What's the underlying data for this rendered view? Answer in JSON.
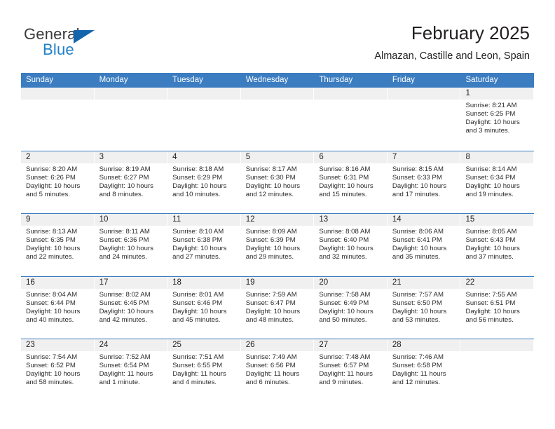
{
  "brand": {
    "name_top": "General",
    "name_bottom": "Blue",
    "accent_color": "#2081c8",
    "triangle_color": "#1565ad"
  },
  "header": {
    "title": "February 2025",
    "subtitle": "Almazan, Castille and Leon, Spain"
  },
  "theme": {
    "header_row_bg": "#3b7dc0",
    "daynum_band_bg": "#f0f0f0",
    "text_color": "#231f20",
    "row_divider": "#3b7dc0"
  },
  "calendar": {
    "weekday_headers": [
      "Sunday",
      "Monday",
      "Tuesday",
      "Wednesday",
      "Thursday",
      "Friday",
      "Saturday"
    ],
    "weeks": [
      [
        {
          "day": "",
          "lines": []
        },
        {
          "day": "",
          "lines": []
        },
        {
          "day": "",
          "lines": []
        },
        {
          "day": "",
          "lines": []
        },
        {
          "day": "",
          "lines": []
        },
        {
          "day": "",
          "lines": []
        },
        {
          "day": "1",
          "sunrise": "Sunrise: 8:21 AM",
          "sunset": "Sunset: 6:25 PM",
          "daylight_1": "Daylight: 10 hours",
          "daylight_2": "and 3 minutes."
        }
      ],
      [
        {
          "day": "2",
          "sunrise": "Sunrise: 8:20 AM",
          "sunset": "Sunset: 6:26 PM",
          "daylight_1": "Daylight: 10 hours",
          "daylight_2": "and 5 minutes."
        },
        {
          "day": "3",
          "sunrise": "Sunrise: 8:19 AM",
          "sunset": "Sunset: 6:27 PM",
          "daylight_1": "Daylight: 10 hours",
          "daylight_2": "and 8 minutes."
        },
        {
          "day": "4",
          "sunrise": "Sunrise: 8:18 AM",
          "sunset": "Sunset: 6:29 PM",
          "daylight_1": "Daylight: 10 hours",
          "daylight_2": "and 10 minutes."
        },
        {
          "day": "5",
          "sunrise": "Sunrise: 8:17 AM",
          "sunset": "Sunset: 6:30 PM",
          "daylight_1": "Daylight: 10 hours",
          "daylight_2": "and 12 minutes."
        },
        {
          "day": "6",
          "sunrise": "Sunrise: 8:16 AM",
          "sunset": "Sunset: 6:31 PM",
          "daylight_1": "Daylight: 10 hours",
          "daylight_2": "and 15 minutes."
        },
        {
          "day": "7",
          "sunrise": "Sunrise: 8:15 AM",
          "sunset": "Sunset: 6:33 PM",
          "daylight_1": "Daylight: 10 hours",
          "daylight_2": "and 17 minutes."
        },
        {
          "day": "8",
          "sunrise": "Sunrise: 8:14 AM",
          "sunset": "Sunset: 6:34 PM",
          "daylight_1": "Daylight: 10 hours",
          "daylight_2": "and 19 minutes."
        }
      ],
      [
        {
          "day": "9",
          "sunrise": "Sunrise: 8:13 AM",
          "sunset": "Sunset: 6:35 PM",
          "daylight_1": "Daylight: 10 hours",
          "daylight_2": "and 22 minutes."
        },
        {
          "day": "10",
          "sunrise": "Sunrise: 8:11 AM",
          "sunset": "Sunset: 6:36 PM",
          "daylight_1": "Daylight: 10 hours",
          "daylight_2": "and 24 minutes."
        },
        {
          "day": "11",
          "sunrise": "Sunrise: 8:10 AM",
          "sunset": "Sunset: 6:38 PM",
          "daylight_1": "Daylight: 10 hours",
          "daylight_2": "and 27 minutes."
        },
        {
          "day": "12",
          "sunrise": "Sunrise: 8:09 AM",
          "sunset": "Sunset: 6:39 PM",
          "daylight_1": "Daylight: 10 hours",
          "daylight_2": "and 29 minutes."
        },
        {
          "day": "13",
          "sunrise": "Sunrise: 8:08 AM",
          "sunset": "Sunset: 6:40 PM",
          "daylight_1": "Daylight: 10 hours",
          "daylight_2": "and 32 minutes."
        },
        {
          "day": "14",
          "sunrise": "Sunrise: 8:06 AM",
          "sunset": "Sunset: 6:41 PM",
          "daylight_1": "Daylight: 10 hours",
          "daylight_2": "and 35 minutes."
        },
        {
          "day": "15",
          "sunrise": "Sunrise: 8:05 AM",
          "sunset": "Sunset: 6:43 PM",
          "daylight_1": "Daylight: 10 hours",
          "daylight_2": "and 37 minutes."
        }
      ],
      [
        {
          "day": "16",
          "sunrise": "Sunrise: 8:04 AM",
          "sunset": "Sunset: 6:44 PM",
          "daylight_1": "Daylight: 10 hours",
          "daylight_2": "and 40 minutes."
        },
        {
          "day": "17",
          "sunrise": "Sunrise: 8:02 AM",
          "sunset": "Sunset: 6:45 PM",
          "daylight_1": "Daylight: 10 hours",
          "daylight_2": "and 42 minutes."
        },
        {
          "day": "18",
          "sunrise": "Sunrise: 8:01 AM",
          "sunset": "Sunset: 6:46 PM",
          "daylight_1": "Daylight: 10 hours",
          "daylight_2": "and 45 minutes."
        },
        {
          "day": "19",
          "sunrise": "Sunrise: 7:59 AM",
          "sunset": "Sunset: 6:47 PM",
          "daylight_1": "Daylight: 10 hours",
          "daylight_2": "and 48 minutes."
        },
        {
          "day": "20",
          "sunrise": "Sunrise: 7:58 AM",
          "sunset": "Sunset: 6:49 PM",
          "daylight_1": "Daylight: 10 hours",
          "daylight_2": "and 50 minutes."
        },
        {
          "day": "21",
          "sunrise": "Sunrise: 7:57 AM",
          "sunset": "Sunset: 6:50 PM",
          "daylight_1": "Daylight: 10 hours",
          "daylight_2": "and 53 minutes."
        },
        {
          "day": "22",
          "sunrise": "Sunrise: 7:55 AM",
          "sunset": "Sunset: 6:51 PM",
          "daylight_1": "Daylight: 10 hours",
          "daylight_2": "and 56 minutes."
        }
      ],
      [
        {
          "day": "23",
          "sunrise": "Sunrise: 7:54 AM",
          "sunset": "Sunset: 6:52 PM",
          "daylight_1": "Daylight: 10 hours",
          "daylight_2": "and 58 minutes."
        },
        {
          "day": "24",
          "sunrise": "Sunrise: 7:52 AM",
          "sunset": "Sunset: 6:54 PM",
          "daylight_1": "Daylight: 11 hours",
          "daylight_2": "and 1 minute."
        },
        {
          "day": "25",
          "sunrise": "Sunrise: 7:51 AM",
          "sunset": "Sunset: 6:55 PM",
          "daylight_1": "Daylight: 11 hours",
          "daylight_2": "and 4 minutes."
        },
        {
          "day": "26",
          "sunrise": "Sunrise: 7:49 AM",
          "sunset": "Sunset: 6:56 PM",
          "daylight_1": "Daylight: 11 hours",
          "daylight_2": "and 6 minutes."
        },
        {
          "day": "27",
          "sunrise": "Sunrise: 7:48 AM",
          "sunset": "Sunset: 6:57 PM",
          "daylight_1": "Daylight: 11 hours",
          "daylight_2": "and 9 minutes."
        },
        {
          "day": "28",
          "sunrise": "Sunrise: 7:46 AM",
          "sunset": "Sunset: 6:58 PM",
          "daylight_1": "Daylight: 11 hours",
          "daylight_2": "and 12 minutes."
        },
        {
          "day": "",
          "lines": []
        }
      ]
    ]
  }
}
